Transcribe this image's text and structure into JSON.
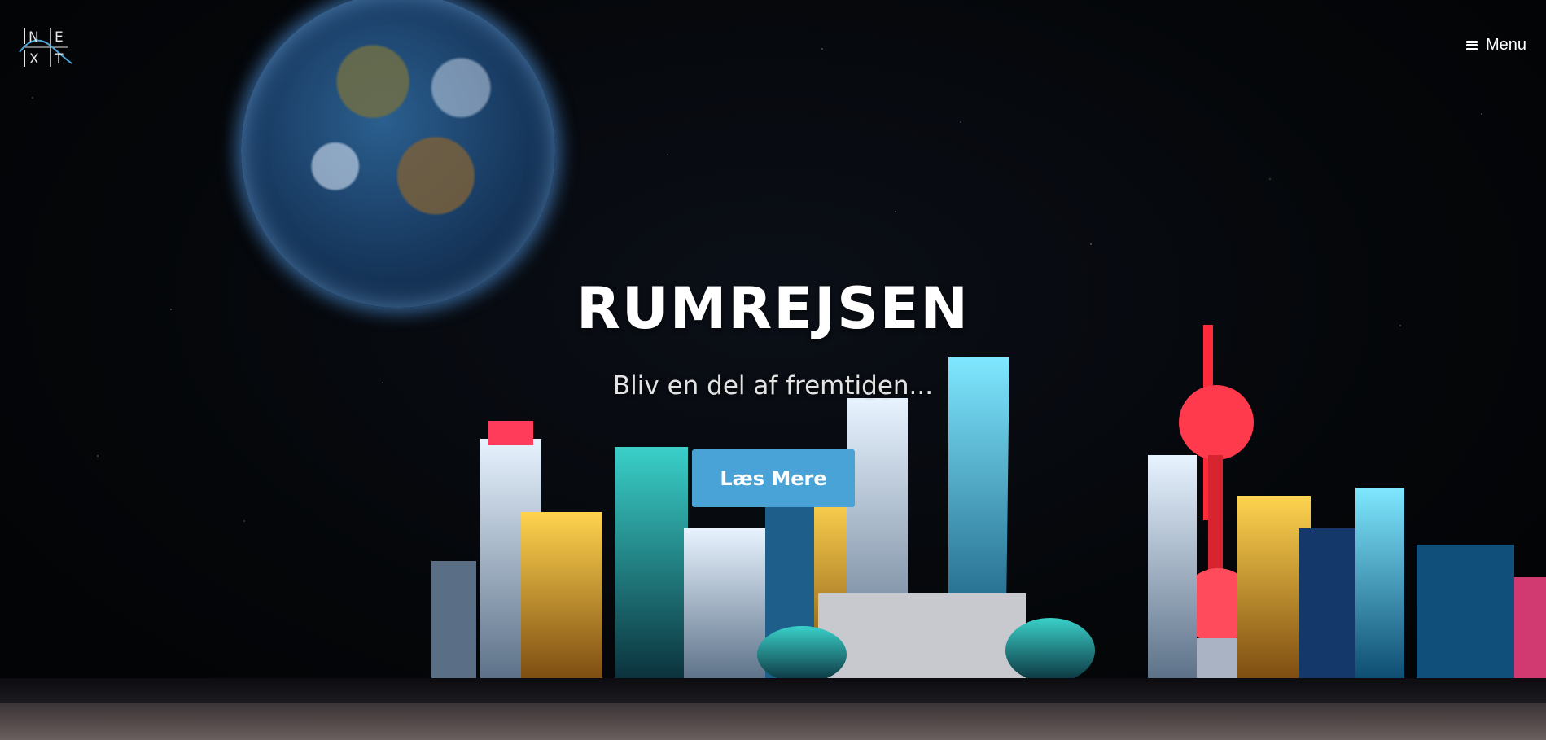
{
  "logo": {
    "letters": [
      "N",
      "E",
      "X",
      "T"
    ]
  },
  "nav": {
    "menu_label": "Menu",
    "menu_icon": "hamburger-icon"
  },
  "hero": {
    "title": "RUMREJSEN",
    "subtitle": "Bliv en del af fremtiden...",
    "cta_label": "Læs Mere"
  },
  "colors": {
    "accent": "#4aa3d6",
    "text": "#ffffff",
    "background": "#05070b"
  }
}
